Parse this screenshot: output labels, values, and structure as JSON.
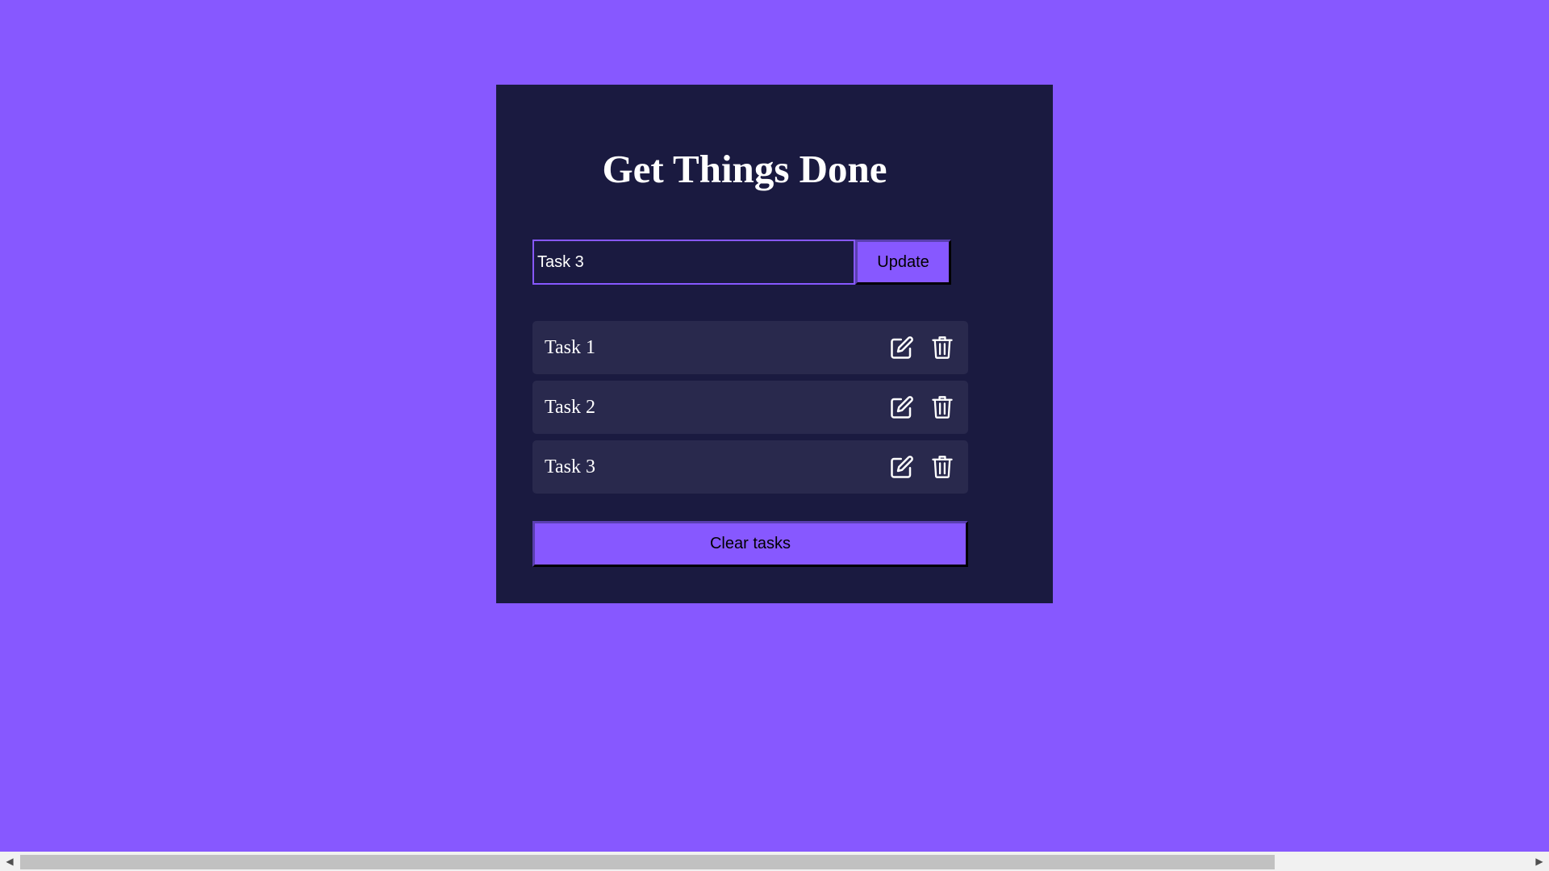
{
  "app": {
    "title": "Get Things Done",
    "background_color": "#8758ff",
    "panel_color": "#1a1a40",
    "item_color": "#29294d"
  },
  "form": {
    "input_value": "Task 3",
    "submit_label": "Update"
  },
  "tasks": [
    {
      "label": "Task 1",
      "edit_icon": "edit-icon",
      "delete_icon": "trash-icon"
    },
    {
      "label": "Task 2",
      "edit_icon": "edit-icon",
      "delete_icon": "trash-icon"
    },
    {
      "label": "Task 3",
      "edit_icon": "edit-icon",
      "delete_icon": "trash-icon"
    }
  ],
  "actions": {
    "clear_label": "Clear tasks"
  },
  "scrollbar": {
    "left_arrow": "◀",
    "right_arrow": "▶"
  }
}
